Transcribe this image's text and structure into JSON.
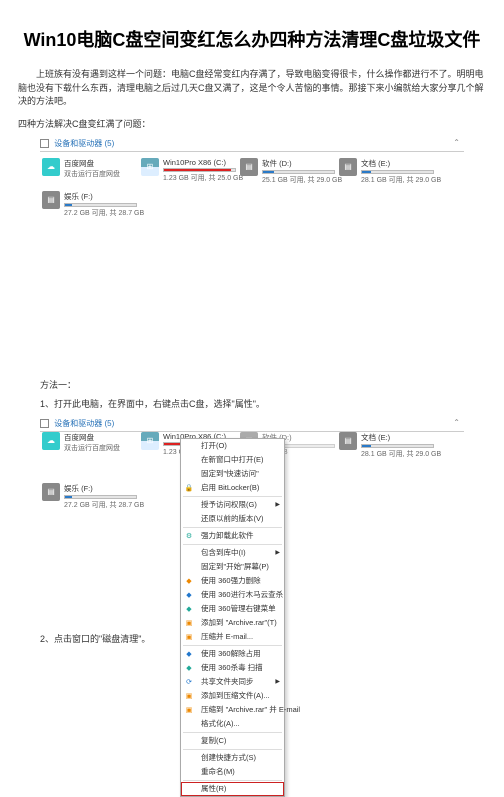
{
  "title": "Win10电脑C盘空间变红怎么办四种方法清理C盘垃圾文件",
  "intro": "上班族有没有遇到这样一个问题：电脑C盘经常变红内存满了，导致电脑变得很卡，什么操作都进行不了。明明电脑也没有下载什么东西，清理电脑之后过几天C盘又满了，这是个令人苦恼的事情。那接下来小编就给大家分享几个解决的方法吧。",
  "subhead": "四种方法解决C盘变红满了问题：",
  "section_header": "设备和驱动器 (5)",
  "drives": {
    "bd": {
      "label": "百度网盘",
      "sub": "双击运行百度网盘"
    },
    "c": {
      "label": "Win10Pro X86 (C:)",
      "sub": "1.23 GB 可用, 共 25.0 GB"
    },
    "d": {
      "label": "软件 (D:)",
      "sub": "25.1 GB 可用, 共 29.0 GB"
    },
    "e": {
      "label": "文档 (E:)",
      "sub": "28.1 GB 可用, 共 29.0 GB"
    },
    "f": {
      "label": "娱乐 (F:)",
      "sub": "27.2 GB 可用, 共 28.7 GB"
    }
  },
  "method1": "方法一：",
  "step1": "1、打开此电脑，在界面中，右键点击C盘，选择\"属性\"。",
  "step2": "2、点击窗口的\"磁盘清理\"。",
  "shot2": {
    "header": "设备和驱动器 (5)",
    "drives": {
      "bd": {
        "label": "百度网盘",
        "sub": "双击运行百度网盘"
      },
      "c": {
        "label": "Win10Pro X86 (C:)",
        "sub": "1.23 GB 可用, 共 25.0 GB"
      },
      "d": {
        "label": "软件 (D:)",
        "sub": "29.0 GB"
      },
      "e": {
        "label": "文档 (E:)",
        "sub": "28.1 GB 可用, 共 29.0 GB"
      },
      "f": {
        "label": "娱乐 (F:)",
        "sub": "27.2 GB 可用, 共 28.7 GB"
      }
    }
  },
  "menu": [
    {
      "t": "打开(O)"
    },
    {
      "t": "在新窗口中打开(E)"
    },
    {
      "t": "固定到\"快速访问\""
    },
    {
      "t": "启用 BitLocker(B)",
      "ico": "🔒",
      "cls": "ico-dark"
    },
    {
      "sep": true
    },
    {
      "t": "授予访问权限(G)",
      "arr": true
    },
    {
      "t": "还原以前的版本(V)"
    },
    {
      "sep": true
    },
    {
      "t": "强力卸载此软件",
      "ico": "⚙",
      "cls": "ico-green"
    },
    {
      "sep": true
    },
    {
      "t": "包含到库中(I)",
      "arr": true
    },
    {
      "t": "固定到\"开始\"屏幕(P)"
    },
    {
      "t": "使用 360强力删除",
      "ico": "◆",
      "cls": "ico-orange"
    },
    {
      "t": "使用 360进行木马云查杀",
      "ico": "◆",
      "cls": "ico-blue"
    },
    {
      "t": "使用 360管理右键菜单",
      "ico": "◆",
      "cls": "ico-green"
    },
    {
      "t": "添加到 \"Archive.rar\"(T)",
      "ico": "▣",
      "cls": "ico-orange"
    },
    {
      "t": "压缩并 E-mail...",
      "ico": "▣",
      "cls": "ico-orange"
    },
    {
      "sep": true
    },
    {
      "t": "使用 360解除占用",
      "ico": "◆",
      "cls": "ico-blue"
    },
    {
      "t": "使用 360杀毒 扫描",
      "ico": "◆",
      "cls": "ico-green"
    },
    {
      "t": "共享文件夹同步",
      "arr": true,
      "ico": "⟳",
      "cls": "ico-blue"
    },
    {
      "t": "添加到压缩文件(A)...",
      "ico": "▣",
      "cls": "ico-orange"
    },
    {
      "t": "压缩到 \"Archive.rar\" 并 E-mail",
      "ico": "▣",
      "cls": "ico-orange"
    },
    {
      "t": "格式化(A)..."
    },
    {
      "sep": true
    },
    {
      "t": "复制(C)"
    },
    {
      "sep": true
    },
    {
      "t": "创建快捷方式(S)"
    },
    {
      "t": "重命名(M)"
    },
    {
      "sep": true
    },
    {
      "t": "属性(R)",
      "hl": true
    }
  ]
}
